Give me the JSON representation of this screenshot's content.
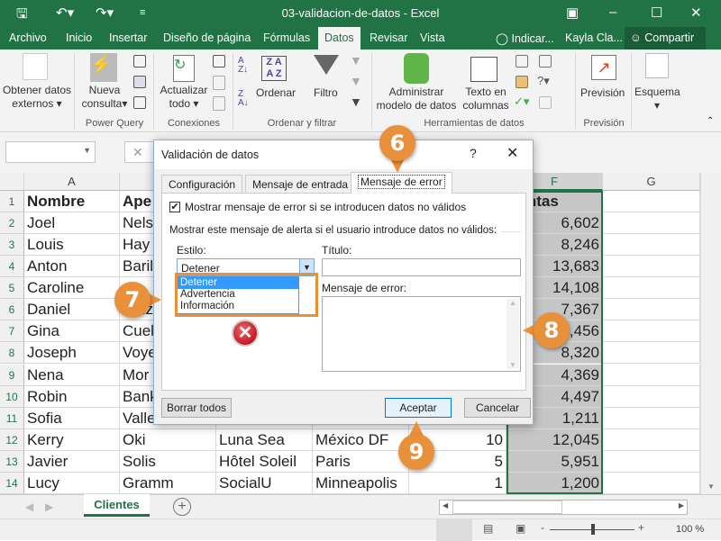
{
  "window": {
    "title": "03-validacion-de-datos  -  Excel"
  },
  "menu": {
    "items": [
      "Archivo",
      "Inicio",
      "Insertar",
      "Diseño de página",
      "Fórmulas",
      "Datos",
      "Revisar",
      "Vista"
    ],
    "tell_me": "Indicar...",
    "user": "Kayla Cla...",
    "share": "Compartir"
  },
  "ribbon": {
    "get_data": [
      "Obtener datos",
      "externos"
    ],
    "new_query": [
      "Nueva",
      "consulta"
    ],
    "refresh": [
      "Actualizar",
      "todo"
    ],
    "sort": "Ordenar",
    "filter": "Filtro",
    "data_model": [
      "Administrar",
      "modelo de datos"
    ],
    "text_cols": [
      "Texto en",
      "columnas"
    ],
    "forecast": "Previsión",
    "outline": "Esquema",
    "groups": [
      "Power Query",
      "Conexiones",
      "Ordenar y filtrar",
      "Herramientas de datos",
      "Previsión"
    ]
  },
  "sheet": {
    "columns": [
      "A",
      "",
      "",
      "",
      "",
      "F",
      "G"
    ],
    "headers": [
      "Nombre",
      "Ape",
      "",
      "",
      "",
      "Ventas"
    ],
    "rows": [
      {
        "n": "2",
        "a": "Joel",
        "b": "Nels",
        "c": "",
        "d": "",
        "e": "",
        "f": "6,602"
      },
      {
        "n": "3",
        "a": "Louis",
        "b": "Hay",
        "c": "",
        "d": "",
        "e": "",
        "f": "8,246"
      },
      {
        "n": "4",
        "a": "Anton",
        "b": "Baril",
        "c": "",
        "d": "",
        "e": "",
        "f": "13,683"
      },
      {
        "n": "5",
        "a": "Caroline",
        "b": "",
        "c": "",
        "d": "",
        "e": "",
        "f": "14,108"
      },
      {
        "n": "6",
        "a": "Daniel",
        "b": "Ruiz",
        "c": "",
        "d": "",
        "e": "",
        "f": "7,367"
      },
      {
        "n": "7",
        "a": "Gina",
        "b": "Cuel",
        "c": "",
        "d": "",
        "e": "",
        "f": "5,456"
      },
      {
        "n": "8",
        "a": "Joseph",
        "b": "Voye",
        "c": "",
        "d": "",
        "e": "",
        "f": "8,320"
      },
      {
        "n": "9",
        "a": "Nena",
        "b": "Mor",
        "c": "",
        "d": "",
        "e": "",
        "f": "4,369"
      },
      {
        "n": "10",
        "a": "Robin",
        "b": "Bank",
        "c": "",
        "d": "",
        "e": "",
        "f": "4,497"
      },
      {
        "n": "11",
        "a": "Sofia",
        "b": "Valle",
        "c": "",
        "d": "",
        "e": "",
        "f": "1,211"
      },
      {
        "n": "12",
        "a": "Kerry",
        "b": "Oki",
        "c": "Luna Sea",
        "d": "México DF",
        "e": "10",
        "f": "12,045"
      },
      {
        "n": "13",
        "a": "Javier",
        "b": "Solis",
        "c": "Hôtel Soleil",
        "d": "Paris",
        "e": "5",
        "f": "5,951"
      },
      {
        "n": "14",
        "a": "Lucy",
        "b": "Gramm",
        "c": "SocialU",
        "d": "Minneapolis",
        "e": "1",
        "f": "1,200"
      }
    ],
    "tab": "Clientes",
    "zoom": "100 %"
  },
  "dialog": {
    "title": "Validación de datos",
    "help": "?",
    "tabs": [
      "Configuración",
      "Mensaje de entrada",
      "Mensaje de error"
    ],
    "show_error_label": "Mostrar mensaje de error si se introducen datos no válidos",
    "show_error_checked": true,
    "section_label": "Mostrar este mensaje de alerta si el usuario introduce datos no válidos:",
    "style_label": "Estilo:",
    "style_value": "Detener",
    "style_options": [
      "Detener",
      "Advertencia",
      "Información"
    ],
    "title_label": "Título:",
    "title_value": "",
    "message_label": "Mensaje de error:",
    "message_value": "",
    "clear_all": "Borrar todos",
    "ok": "Aceptar",
    "cancel": "Cancelar"
  },
  "callouts": [
    "6",
    "7",
    "8",
    "9"
  ],
  "colors": {
    "excel_green": "#217346",
    "callout": "#e8903a",
    "selection": "#3399ff"
  }
}
